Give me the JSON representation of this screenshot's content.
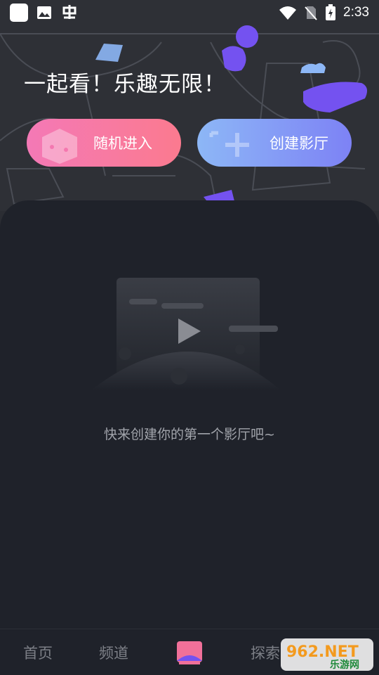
{
  "status_bar": {
    "time": "2:33",
    "icons": [
      "app-square-icon",
      "image-icon",
      "bug-icon",
      "wifi-icon",
      "no-sim-icon",
      "battery-charging-icon"
    ]
  },
  "hero": {
    "title": "一起看！乐趣无限！",
    "random_button": "随机进入",
    "create_button": "创建影厅"
  },
  "empty_state": {
    "message": "快来创建你的第一个影厅吧~"
  },
  "nav": {
    "items": [
      "首页",
      "频道",
      "探索"
    ],
    "active_icon": "cinema-icon"
  },
  "watermark": {
    "brand": "962.NET",
    "sub": "乐游网"
  },
  "colors": {
    "random_gradient": [
      "#f479b6",
      "#fb7a8f"
    ],
    "create_gradient": [
      "#8db7f6",
      "#7d82f5"
    ],
    "accent_purple": "#7452f0",
    "active_nav": "#f07099"
  }
}
